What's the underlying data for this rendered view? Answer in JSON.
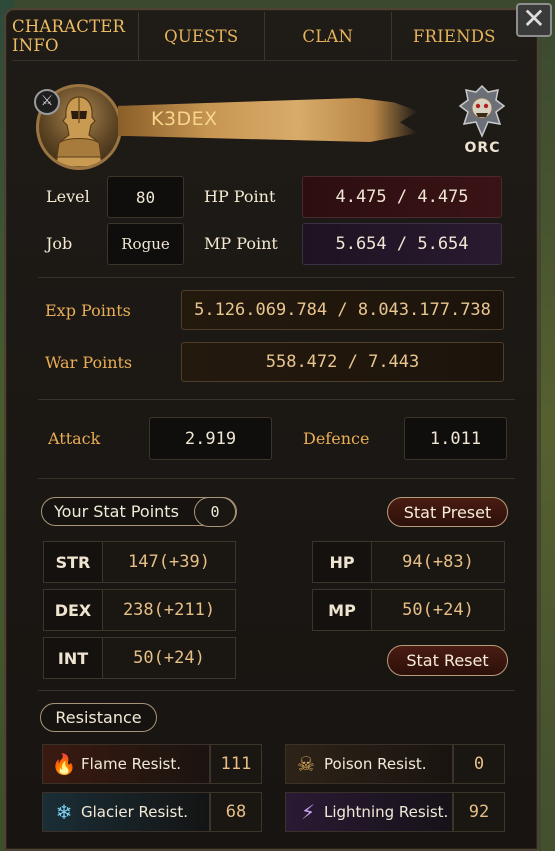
{
  "close_label": "✕",
  "tabs": [
    "CHARACTER INFO",
    "QUESTS",
    "CLAN",
    "FRIENDS"
  ],
  "profile": {
    "name": "K3DEX",
    "race": "ORC"
  },
  "basic": {
    "level_label": "Level",
    "level_value": "80",
    "job_label": "Job",
    "job_value": "Rogue",
    "hp_label": "HP Point",
    "hp_value": "4.475 / 4.475",
    "mp_label": "MP Point",
    "mp_value": "5.654 / 5.654"
  },
  "progress": {
    "exp_label": "Exp Points",
    "exp_value": "5.126.069.784 / 8.043.177.738",
    "war_label": "War Points",
    "war_value": "558.472 / 7.443"
  },
  "combat": {
    "attack_label": "Attack",
    "attack_value": "2.919",
    "defence_label": "Defence",
    "defence_value": "1.011"
  },
  "stats": {
    "points_label": "Your Stat Points",
    "points_value": "0",
    "preset_label": "Stat  Preset",
    "reset_label": "Stat Reset",
    "left": [
      {
        "key": "STR",
        "value": "147(+39)"
      },
      {
        "key": "DEX",
        "value": "238(+211)"
      },
      {
        "key": "INT",
        "value": "50(+24)"
      }
    ],
    "right": [
      {
        "key": "HP",
        "value": "94(+83)"
      },
      {
        "key": "MP",
        "value": "50(+24)"
      }
    ]
  },
  "resistance": {
    "title": "Resistance",
    "items": [
      {
        "name": "Flame Resist.",
        "value": "111",
        "icon": "flame-icon",
        "color": "#e06a2a"
      },
      {
        "name": "Poison Resist.",
        "value": "0",
        "icon": "skull-icon",
        "color": "#d9a85a"
      },
      {
        "name": "Glacier Resist.",
        "value": "68",
        "icon": "snowflake-icon",
        "color": "#7fd0f0"
      },
      {
        "name": "Lightning Resist.",
        "value": "92",
        "icon": "lightning-icon",
        "color": "#c9a2f0"
      }
    ]
  }
}
